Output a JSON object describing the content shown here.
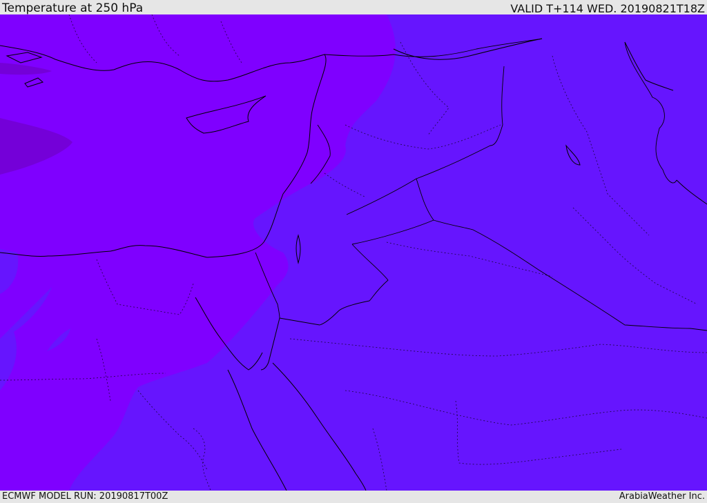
{
  "header": {
    "title": "Temperature at 250 hPa",
    "valid_time": "VALID T+114 WED. 20190821T18Z"
  },
  "footer": {
    "model_run": "ECMWF MODEL RUN: 20190817T00Z",
    "credit": "ArabiaWeather Inc."
  },
  "colors": {
    "warm_zone": "#7f00ff",
    "warmest_pocket": "#7400d8",
    "cool_zone": "#6615fe",
    "outline": "#000000",
    "frame": "#e6e6e6"
  }
}
